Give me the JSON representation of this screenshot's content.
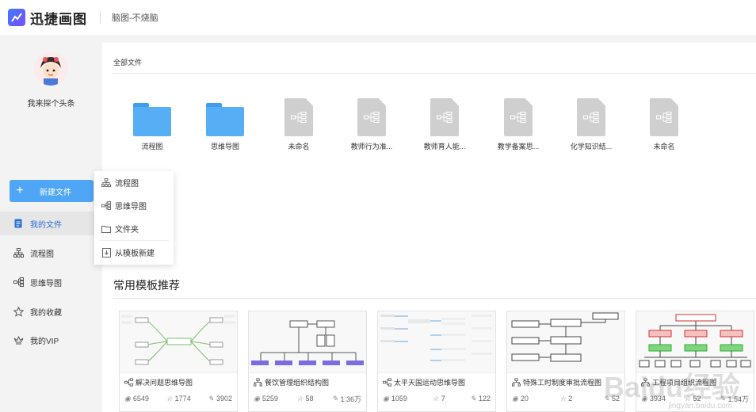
{
  "header": {
    "app_name": "迅捷画图",
    "doc_name": "脑图-不烧脑"
  },
  "user": {
    "name": "我来探个头条"
  },
  "sidebar": {
    "new_button": "新建文件",
    "items": [
      {
        "label": "我的文件",
        "icon": "file-icon",
        "active": true
      },
      {
        "label": "流程图",
        "icon": "flowchart-icon"
      },
      {
        "label": "思维导图",
        "icon": "mindmap-icon"
      },
      {
        "label": "我的收藏",
        "icon": "star-icon"
      },
      {
        "label": "我的VIP",
        "icon": "crown-icon"
      }
    ]
  },
  "dropdown": {
    "items": [
      {
        "label": "流程图",
        "icon": "flowchart-icon"
      },
      {
        "label": "思维导图",
        "icon": "mindmap-icon"
      },
      {
        "label": "文件夹",
        "icon": "folder-icon"
      },
      {
        "label": "从模板新建",
        "icon": "template-icon"
      }
    ]
  },
  "main": {
    "breadcrumb": "全部文件",
    "files": [
      {
        "name": "流程图",
        "type": "folder"
      },
      {
        "name": "思维导图",
        "type": "folder"
      },
      {
        "name": "未命名",
        "type": "doc"
      },
      {
        "name": "教师行为准...",
        "type": "doc"
      },
      {
        "name": "教师育人能...",
        "type": "doc"
      },
      {
        "name": "教学备案思...",
        "type": "doc"
      },
      {
        "name": "化学知识结...",
        "type": "doc"
      },
      {
        "name": "未命名",
        "type": "doc"
      }
    ],
    "templates_title": "常用模板推荐",
    "templates": [
      {
        "title": "解决问题思维导图",
        "views": "6549",
        "stars": "1774",
        "uses": "3902"
      },
      {
        "title": "餐饮管理组织结构图",
        "views": "5259",
        "stars": "58",
        "uses": "1.36万"
      },
      {
        "title": "太平天国运动思维导图",
        "views": "1059",
        "stars": "7",
        "uses": "122"
      },
      {
        "title": "特殊工时制度审批流程图",
        "views": "20",
        "stars": "2",
        "uses": "52"
      },
      {
        "title": "工程项目组织流程图",
        "views": "3934",
        "stars": "52",
        "uses": "1.54万"
      }
    ]
  },
  "watermark": {
    "text": "Baidu经验",
    "sub": "jingyan.baidu.com"
  },
  "colors": {
    "accent": "#4fa6f6",
    "folder": "#56aef5",
    "doc": "#cfcfcf",
    "active_text": "#2a6fd6"
  }
}
